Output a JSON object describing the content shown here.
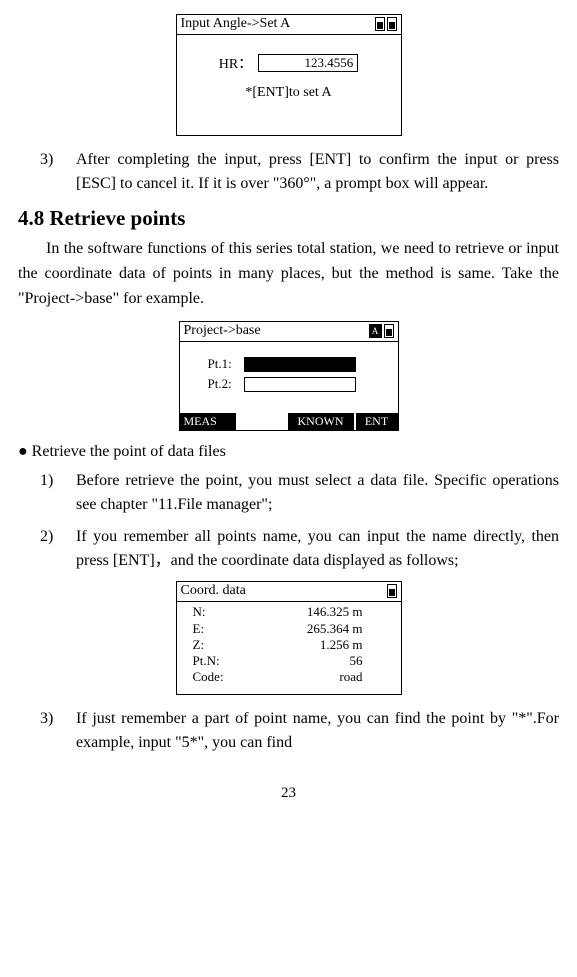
{
  "box1": {
    "title": "Input Angle->Set A",
    "hr_label": "HR：",
    "hr_value": "123.4556",
    "hint": "*[ENT]to set A"
  },
  "item3_top": "After completing the input, press [ENT] to confirm the input or press [ESC] to cancel it. If it is over \"360°\", a prompt box will appear.",
  "section_title": "4.8 Retrieve points",
  "para1": "In the software functions of this series total station, we need to retrieve or input the coordinate data of points in many places, but the method is same. Take the \"Project->base\" for example.",
  "box2": {
    "title": "Project->base",
    "ind_letter": "A",
    "pt1_label": "Pt.1:",
    "pt2_label": "Pt.2:",
    "btn_meas": "MEAS",
    "btn_known": "KNOWN",
    "btn_ent": "ENT"
  },
  "bullet": "● Retrieve the point of data files",
  "list": {
    "n1": "1)",
    "t1": "Before retrieve the point, you must select a data file. Specific operations see chapter \"11.File manager\";",
    "n2": "2)",
    "t2": "If you remember all points name, you can input the name directly, then press [ENT]，and the coordinate data displayed as follows;"
  },
  "box3": {
    "title": "Coord. data",
    "rows": {
      "n_l": "N:",
      "n_v": "146.325 m",
      "e_l": "E:",
      "e_v": "265.364 m",
      "z_l": "Z:",
      "z_v": "1.256 m",
      "p_l": "Pt.N:",
      "p_v": "56",
      "c_l": "Code:",
      "c_v": "road"
    }
  },
  "item3_bottom_n": "3)",
  "item3_bottom": "If just remember a part of point name, you can find the point by \"*\".For example, input \"5*\", you can find",
  "page_number": "23",
  "n3_top": "3)"
}
